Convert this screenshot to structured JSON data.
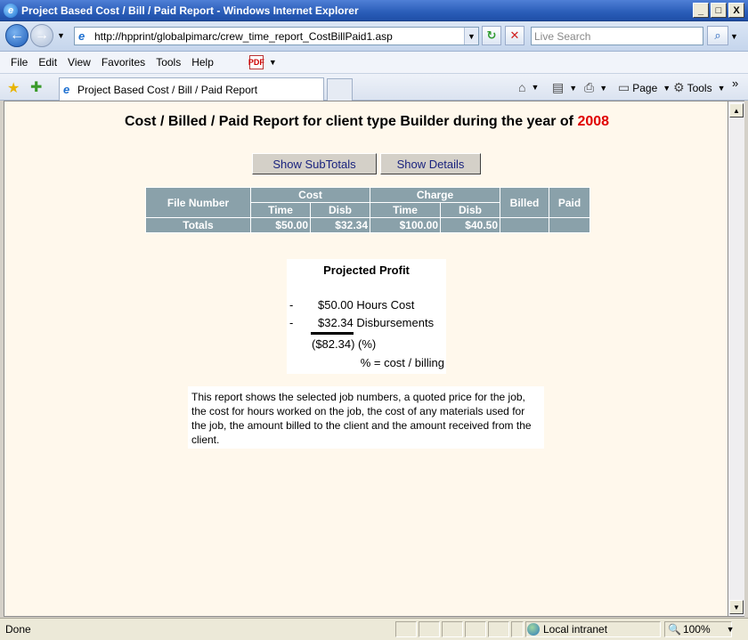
{
  "window": {
    "title": "Project Based Cost / Bill / Paid Report - Windows Internet Explorer",
    "min_label": "_",
    "max_label": "□",
    "close_label": "X",
    "app_icon": "e"
  },
  "address": {
    "back_icon": "←",
    "forward_icon": "→",
    "dropdown": "▼",
    "url": "http://hpprint/globalpimarc/crew_time_report_CostBillPaid1.asp",
    "refresh_icon": "↻",
    "stop_icon": "✕",
    "search_placeholder": "Live Search",
    "search_icon": "⌕"
  },
  "menu": {
    "file": "File",
    "edit": "Edit",
    "view": "View",
    "favorites": "Favorites",
    "tools": "Tools",
    "help": "Help"
  },
  "tabs": {
    "active_tab": "Project Based Cost / Bill / Paid Report",
    "page_label": "Page",
    "tools_label": "Tools"
  },
  "report": {
    "title_prefix": "Cost / Billed / Paid Report for client type Builder during the year of ",
    "year": "2008",
    "show_subtotals": "Show SubTotals",
    "show_details": "Show Details",
    "table": {
      "file_number": "File Number",
      "cost": "Cost",
      "charge": "Charge",
      "billed": "Billed",
      "paid": "Paid",
      "time": "Time",
      "disb": "Disb",
      "totals_label": "Totals",
      "cost_time": "$50.00",
      "cost_disb": "$32.34",
      "charge_time": "$100.00",
      "charge_disb": "$40.50",
      "billed_value": "",
      "paid_value": ""
    },
    "profit": {
      "title": "Projected Profit",
      "dash": "-",
      "hours_cost": "$50.00 Hours Cost",
      "disbursements": "$32.34 Disbursements",
      "result": "($82.34) (%)",
      "note": "% = cost / billing"
    },
    "description": "This report shows the selected job numbers, a quoted price for the job, the cost for hours worked on the job, the cost of any materials used for the job, the amount billed to the client and the amount received from the client."
  },
  "status": {
    "text": "Done",
    "zone": "Local intranet",
    "zoom": "100%"
  }
}
